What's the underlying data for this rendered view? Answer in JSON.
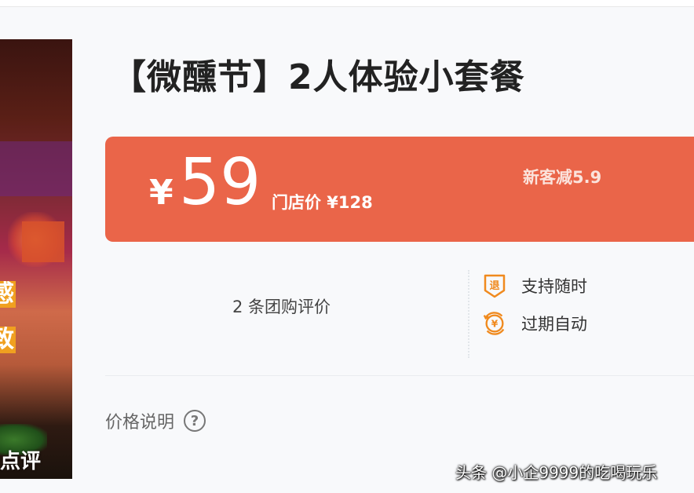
{
  "product_image": {
    "overlay_chars": [
      "感",
      "致"
    ],
    "watermark": "点评"
  },
  "deal": {
    "title": "【微醺节】2人体验小套餐"
  },
  "price": {
    "currency_symbol": "¥",
    "value": "59",
    "original_price": "门店价 ¥128",
    "promo": "新客减5.9"
  },
  "reviews": {
    "count_text": "2 条团购评价"
  },
  "guarantees": [
    {
      "icon": "refund-icon",
      "label": "支持随时"
    },
    {
      "icon": "yen-refund-icon",
      "label": "过期自动"
    }
  ],
  "price_explain": {
    "label": "价格说明",
    "help": "?"
  },
  "watermark": "头条 @小企9999的吃喝玩乐",
  "colors": {
    "price_banner": "#ea6549",
    "icon_orange": "#f08a1e"
  }
}
